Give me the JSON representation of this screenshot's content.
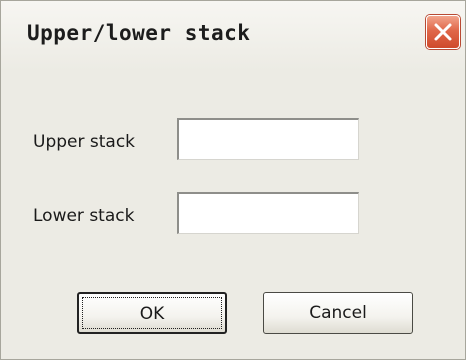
{
  "window": {
    "title": "Upper/lower stack",
    "close_icon": "close-icon"
  },
  "form": {
    "upper_label": "Upper stack",
    "upper_value": "",
    "lower_label": "Lower stack",
    "lower_value": ""
  },
  "buttons": {
    "ok_label": "OK",
    "cancel_label": "Cancel"
  },
  "colors": {
    "dialog_bg": "#ecebe4",
    "close_button": "#e0684a"
  }
}
